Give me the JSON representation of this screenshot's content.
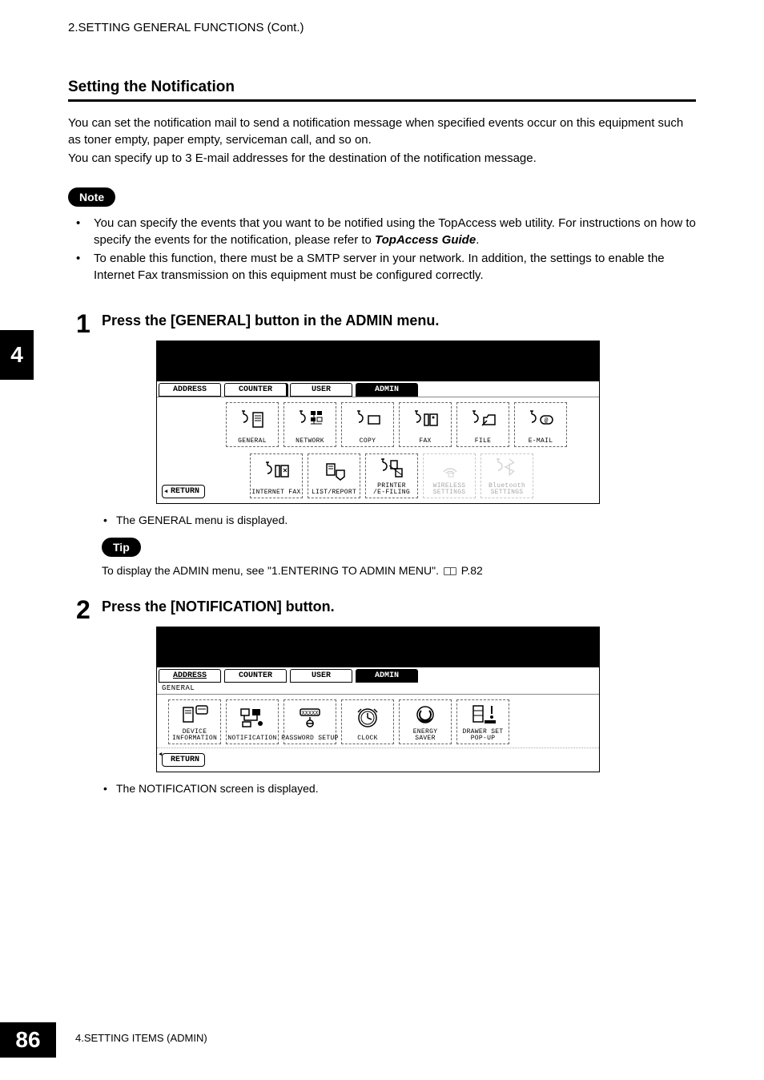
{
  "header_section": "2.SETTING GENERAL FUNCTIONS (Cont.)",
  "section_title": "Setting the Notification",
  "intro_para1": "You can set the notification mail to send a notification message when specified events occur on this equipment such as toner empty, paper empty, serviceman call, and so on.",
  "intro_para2": "You can specify up to 3 E-mail addresses for the destination of the notification message.",
  "note_label": "Note",
  "note_bullet1_a": "You can specify the events that you want to be notified using the TopAccess web utility.  For instructions on how to specify the events for the notification, please refer to ",
  "note_bullet1_b": "TopAccess Guide",
  "note_bullet1_c": ".",
  "note_bullet2": "To enable this function, there must be a SMTP server in your network.  In addition, the settings to enable the Internet Fax transmission on this equipment must be configured correctly.",
  "side_tab": "4",
  "step1_num": "1",
  "step1_title": "Press the [GENERAL] button in the ADMIN menu.",
  "tabs": {
    "address": "ADDRESS",
    "counter": "COUNTER",
    "user": "USER",
    "admin": "ADMIN"
  },
  "admin_icons": {
    "general": "GENERAL",
    "network": "NETWORK",
    "copy": "COPY",
    "fax": "FAX",
    "file": "FILE",
    "email": "E-MAIL",
    "internetfax": "INTERNET FAX",
    "listreport": "LIST/REPORT",
    "printer": "PRINTER\n/E-FILING",
    "wireless": "WIRELESS\nSETTINGS",
    "bluetooth": "Bluetooth\nSETTINGS"
  },
  "return_label": "RETURN",
  "step1_bullet": "The GENERAL menu is displayed.",
  "tip_label": "Tip",
  "tip_text_a": "To display the ADMIN menu, see \"1.ENTERING TO ADMIN MENU\".  ",
  "tip_text_b": " P.82",
  "step2_num": "2",
  "step2_title": "Press the [NOTIFICATION] button.",
  "crumb_general": "GENERAL",
  "general_icons": {
    "device": "DEVICE\nINFORMATION",
    "notification": "NOTIFICATION",
    "password": "PASSWORD SETUP",
    "clock": "CLOCK",
    "energy": "ENERGY\nSAVER",
    "drawer": "DRAWER SET\nPOP-UP"
  },
  "step2_bullet": "The NOTIFICATION screen is displayed.",
  "page_number": "86",
  "footer_text": "4.SETTING ITEMS (ADMIN)"
}
